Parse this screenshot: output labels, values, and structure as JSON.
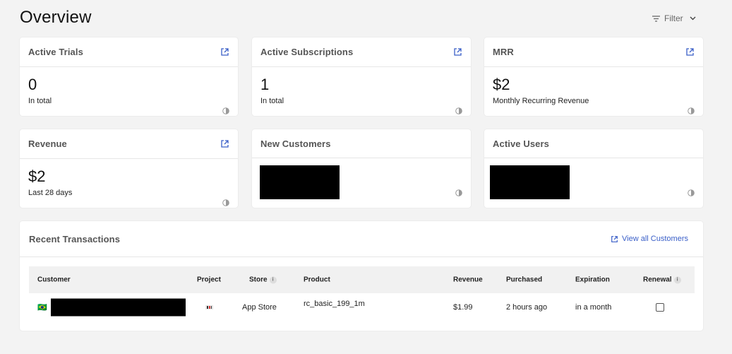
{
  "header": {
    "title": "Overview",
    "filter_label": "Filter"
  },
  "metrics": {
    "active_trials": {
      "title": "Active Trials",
      "value": "0",
      "caption": "In total"
    },
    "active_subscriptions": {
      "title": "Active Subscriptions",
      "value": "1",
      "caption": "In total"
    },
    "mrr": {
      "title": "MRR",
      "value": "$2",
      "caption": "Monthly Recurring Revenue"
    },
    "revenue": {
      "title": "Revenue",
      "value": "$2",
      "caption": "Last 28 days"
    },
    "new_customers": {
      "title": "New Customers"
    },
    "active_users": {
      "title": "Active Users"
    }
  },
  "transactions": {
    "title": "Recent Transactions",
    "view_all_label": "View all Customers",
    "columns": {
      "customer": "Customer",
      "project": "Project",
      "store": "Store",
      "product": "Product",
      "revenue": "Revenue",
      "purchased": "Purchased",
      "expiration": "Expiration",
      "renewal": "Renewal"
    },
    "rows": [
      {
        "flag": "🇧🇷",
        "store": "App Store",
        "product": "rc_basic_199_1m",
        "revenue": "$1.99",
        "purchased": "2 hours ago",
        "expiration": "in a month",
        "renewal": false
      }
    ]
  },
  "colors": {
    "accent": "#3a5fc8",
    "background": "#f3f3f3",
    "card": "#ffffff"
  }
}
